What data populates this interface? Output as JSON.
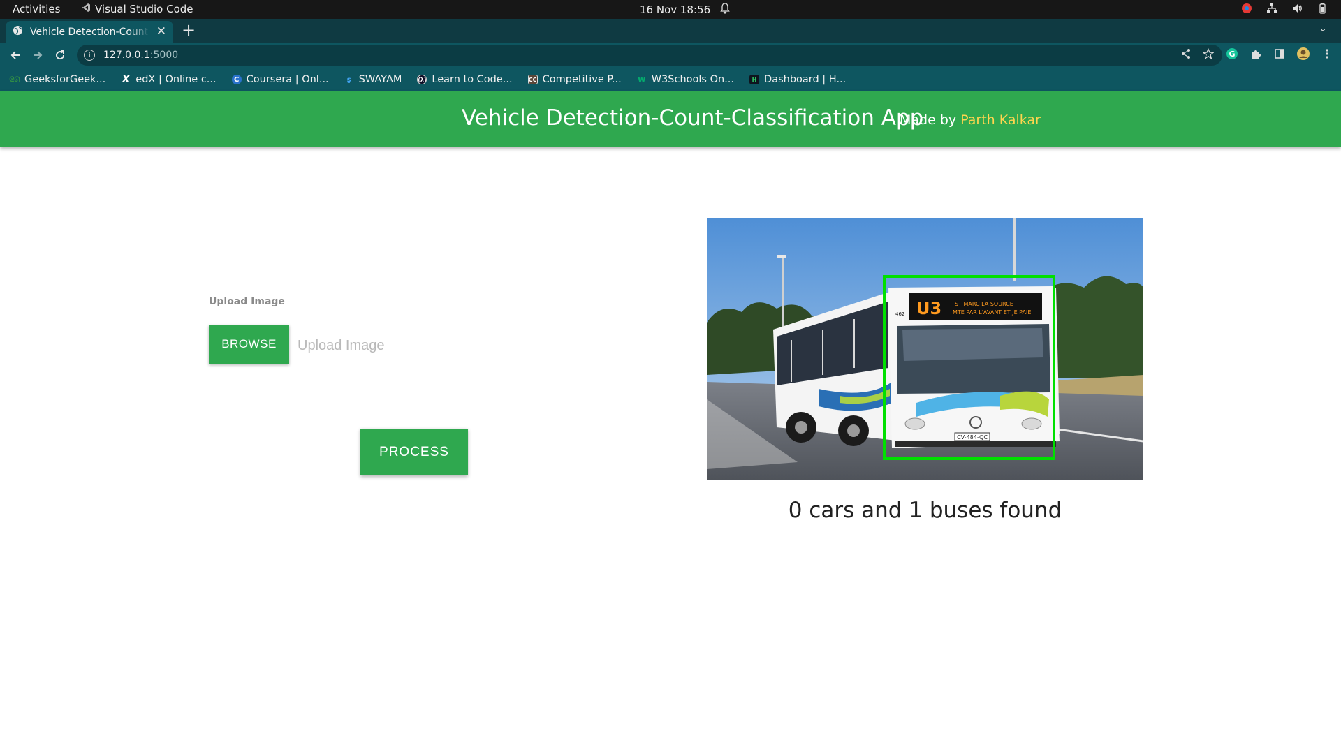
{
  "os": {
    "activities": "Activities",
    "app_name": "Visual Studio Code",
    "datetime": "16 Nov  18:56"
  },
  "browser": {
    "tab_title": "Vehicle Detection-Count-Classification App",
    "url_host": "127.0.0.1",
    "url_port": ":5000",
    "bookmarks": [
      {
        "label": "GeeksforGeek...",
        "icon": "geeksforgeeks-icon",
        "color": "#2f8d46"
      },
      {
        "label": "edX | Online c...",
        "icon": "edx-icon",
        "color": "#000000"
      },
      {
        "label": "Coursera | Onl...",
        "icon": "coursera-icon",
        "color": "#2a73cc"
      },
      {
        "label": "SWAYAM",
        "icon": "swayam-icon",
        "color": "#1e88e5"
      },
      {
        "label": "Learn to Code...",
        "icon": "freecodecamp-icon",
        "color": "#0a0a23"
      },
      {
        "label": "Competitive P...",
        "icon": "codechef-icon",
        "color": "#5b4638"
      },
      {
        "label": "W3Schools On...",
        "icon": "w3schools-icon",
        "color": "#04aa6d"
      },
      {
        "label": "Dashboard | H...",
        "icon": "hackerrank-icon",
        "color": "#0e141e"
      }
    ]
  },
  "app": {
    "title": "Vehicle Detection-Count-Classification App",
    "made_by_prefix": "Made by ",
    "author": "Parth Kalkar",
    "accent": "#2fa84f"
  },
  "upload": {
    "label": "Upload Image",
    "browse_label": "BROWSE",
    "placeholder": "Upload Image",
    "process_label": "PROCESS"
  },
  "result": {
    "text": "0 cars and 1 buses found",
    "image_subject": "bus with green detection bounding box",
    "box_color": "#00e000",
    "bus_sign_route": "U3",
    "bus_sign_text1": "ST MARC  LA SOURCE",
    "bus_sign_text2": "MTE PAR L'AVANT ET JE PAIE",
    "bus_number": "462",
    "plate": "CV-484-QC"
  }
}
